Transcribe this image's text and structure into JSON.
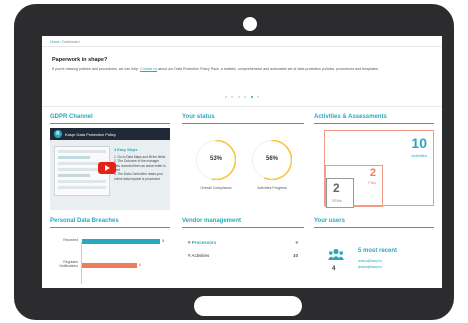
{
  "breadcrumb": {
    "home": "Home",
    "current": "Dashboard"
  },
  "banner": {
    "title": "Paperwork in shape?",
    "text_before": "If you're missing policies and procedures, we can help.",
    "link": "Contact us",
    "text_after": "about our Data Protection Policy Pack, a realistic, comprehensive and actionable set of data protection policies, procedures and templates.",
    "slides": 6,
    "active_slide": 4
  },
  "gdpr_channel": {
    "title": "GDPR Channel",
    "video_title": "Kaspr Data Protection Policy",
    "logo_letter": "K",
    "steps_heading": "3 Easy Steps",
    "steps": [
      "1. Go to Data Maps and fill the fields",
      "2. The Outcome of the manager gets recorded then an action letter is sent",
      "3. The Data Controllers reads your online data request is processed"
    ]
  },
  "status": {
    "title": "Your status",
    "gauges": [
      {
        "value": "53%",
        "fraction": 0.53,
        "label": "Overall Compliance",
        "color": "#f5c83a"
      },
      {
        "value": "56%",
        "fraction": 0.56,
        "label": "Activities Progress",
        "color": "#f5c83a"
      }
    ]
  },
  "activities": {
    "title": "Activities & Assessments",
    "activities_count": "10",
    "activities_label": "Activities",
    "activities_color": "#2aa7bd",
    "pias_count": "2",
    "pias_label": "PIAs",
    "pias_color": "#f07c5e",
    "dpias_count": "2",
    "dpias_label": "DPIAs"
  },
  "breaches": {
    "title": "Personal Data Breaches",
    "rows": [
      {
        "label": "Recorded",
        "count": "3",
        "fraction": 1.0,
        "color": "#2aa7bd"
      },
      {
        "label": "Regulator Notifications",
        "count": "0",
        "fraction": 0.7,
        "color": "#f07c5e"
      }
    ]
  },
  "vendors": {
    "title": "Vendor management",
    "rows": [
      {
        "hash": "#",
        "label": "Processors",
        "value": "9"
      },
      {
        "hash": "#",
        "label": "Activities",
        "value": "10"
      }
    ]
  },
  "users": {
    "title": "Your users",
    "count": "4",
    "recent_title": "5 most recent",
    "emails": [
      "rebeca@kaspr.io",
      "jessica@kaspr.io"
    ]
  }
}
